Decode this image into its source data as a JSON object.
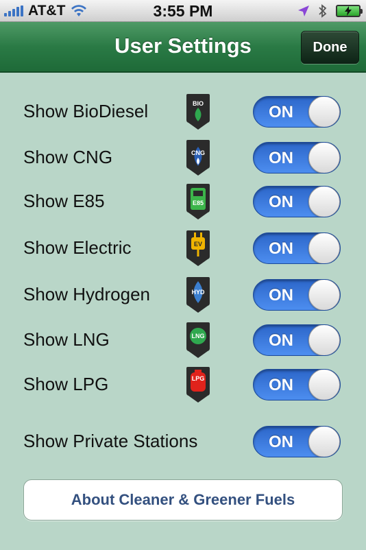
{
  "status_bar": {
    "carrier": "AT&T",
    "time": "3:55 PM",
    "icons": [
      "signal-bars",
      "wifi-icon",
      "location-arrow-icon",
      "bluetooth-icon",
      "battery-charging-icon"
    ]
  },
  "nav": {
    "title": "User Settings",
    "done_label": "Done"
  },
  "settings": [
    {
      "label": "Show BioDiesel",
      "icon_text": "BIO",
      "icon_color": "#2fa84f",
      "value": "ON"
    },
    {
      "label": "Show CNG",
      "icon_text": "CNG",
      "icon_color": "#2a5fb5",
      "value": "ON"
    },
    {
      "label": "Show E85",
      "icon_text": "E85",
      "icon_color": "#3cb54a",
      "value": "ON"
    },
    {
      "label": "Show Electric",
      "icon_text": "EV",
      "icon_color": "#f0b400",
      "value": "ON"
    },
    {
      "label": "Show Hydrogen",
      "icon_text": "HYD",
      "icon_color": "#3b7fd0",
      "value": "ON"
    },
    {
      "label": "Show LNG",
      "icon_text": "LNG",
      "icon_color": "#2fa84f",
      "value": "ON"
    },
    {
      "label": "Show LPG",
      "icon_text": "LPG",
      "icon_color": "#e0231c",
      "value": "ON"
    },
    {
      "label": "Show Private Stations",
      "value": "ON"
    }
  ],
  "about_button": "About Cleaner & Greener Fuels",
  "colors": {
    "background": "#b9d6c8",
    "nav_green": "#2a7a45",
    "toggle_blue": "#2c66c9",
    "about_text": "#33507f"
  }
}
